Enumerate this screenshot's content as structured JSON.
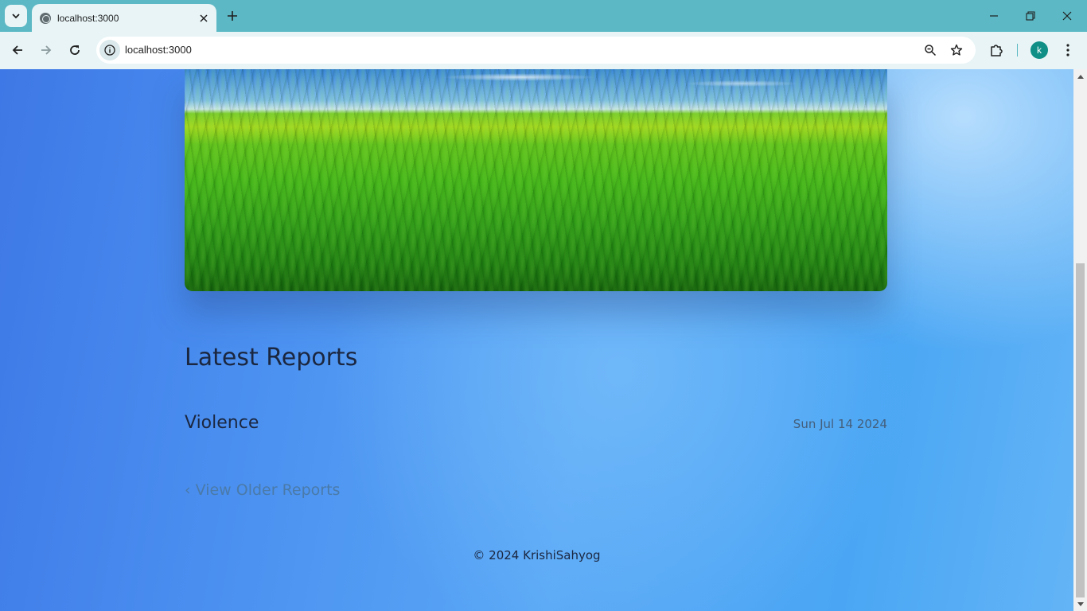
{
  "browser": {
    "tab_title": "localhost:3000",
    "url": "localhost:3000",
    "profile_initial": "k"
  },
  "icons": {
    "tab_search": "chevron-down-icon",
    "favicon": "globe-icon",
    "tab_close": "close-icon",
    "new_tab": "plus-icon",
    "minimize": "minimize-icon",
    "restore": "restore-icon",
    "close_window": "close-icon",
    "back": "arrow-left-icon",
    "forward": "arrow-right-icon",
    "reload": "reload-icon",
    "site_info": "info-icon",
    "zoom": "zoom-icon",
    "bookmark": "star-icon",
    "extensions": "puzzle-icon",
    "menu": "kebab-menu-icon"
  },
  "page": {
    "section_title": "Latest Reports",
    "reports": [
      {
        "title": "Violence",
        "date": "Sun Jul 14 2024"
      }
    ],
    "older_link": "View Older Reports",
    "older_link_icon": "‹",
    "footer": "© 2024 KrishiSahyog"
  },
  "colors": {
    "chrome": "#5bb8c4",
    "toolbar": "#e8f4f6",
    "avatar": "#0f8f86",
    "heading_text": "#1b2740",
    "link_text": "#4a7aa8"
  }
}
